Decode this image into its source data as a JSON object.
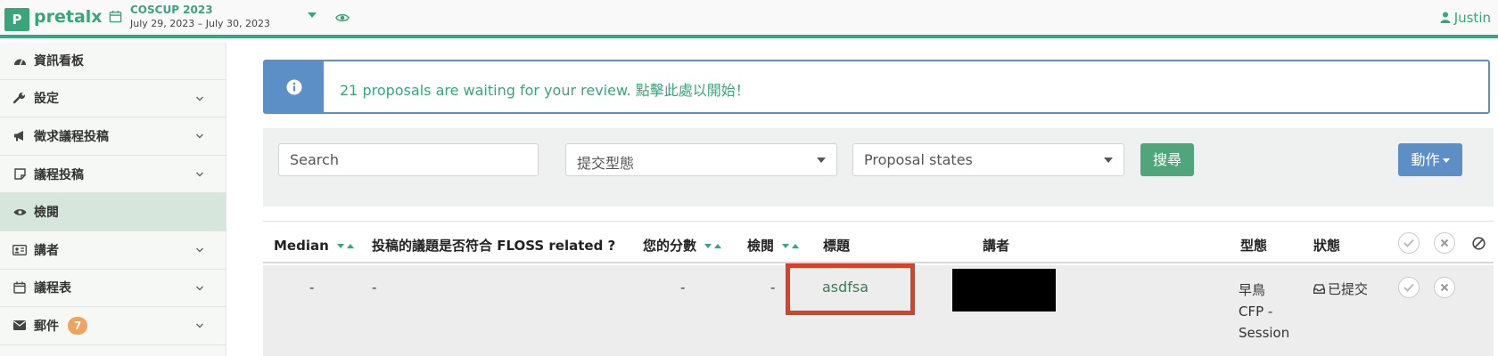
{
  "app": {
    "logo_letter": "P",
    "name": "pretalx"
  },
  "event": {
    "name": "COSCUP 2023",
    "dates": "July 29, 2023 – July 30, 2023"
  },
  "user": {
    "name": "Justin"
  },
  "sidebar": {
    "items": [
      {
        "label": "資訊看板",
        "icon": "dashboard-icon",
        "expandable": false
      },
      {
        "label": "設定",
        "icon": "wrench-icon",
        "expandable": true
      },
      {
        "label": "徵求議程投稿",
        "icon": "megaphone-icon",
        "expandable": true
      },
      {
        "label": "議程投稿",
        "icon": "note-icon",
        "expandable": true
      },
      {
        "label": "檢閱",
        "icon": "eye-icon",
        "expandable": false,
        "active": true
      },
      {
        "label": "講者",
        "icon": "id-card-icon",
        "expandable": true
      },
      {
        "label": "議程表",
        "icon": "calendar-icon",
        "expandable": true
      },
      {
        "label": "郵件",
        "icon": "envelope-icon",
        "expandable": true,
        "badge": "7"
      }
    ]
  },
  "alert": {
    "text": "21 proposals are waiting for your review. 點擊此處以開始！"
  },
  "filters": {
    "search_placeholder": "Search",
    "type_placeholder": "提交型態",
    "state_placeholder": "Proposal states",
    "search_button": "搜尋",
    "action_button": "動作"
  },
  "table": {
    "headers": {
      "median": "Median",
      "floss": "投稿的議題是否符合 FLOSS related ?",
      "your_score": "您的分數",
      "review": "檢閱",
      "title": "標題",
      "speaker": "講者",
      "type": "型態",
      "state": "狀態"
    },
    "rows": [
      {
        "median": "-",
        "floss": "-",
        "your_score": "-",
        "review": "-",
        "title": "asdfsa",
        "type_line1": "早鳥",
        "type_line2": "CFP -",
        "type_line3": "Session",
        "state": "已提交"
      }
    ]
  },
  "colors": {
    "accent": "#3aa57a",
    "info": "#5b8fc6",
    "badge": "#f0a35e",
    "highlight": "#d9402b"
  }
}
